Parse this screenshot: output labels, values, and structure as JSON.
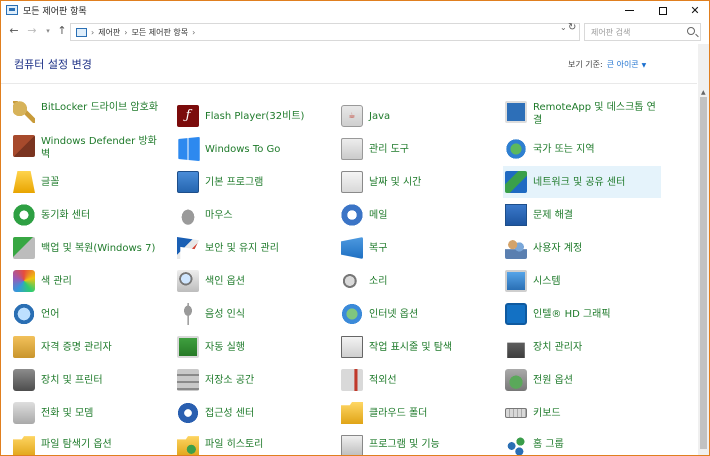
{
  "window": {
    "title": "모든 제어판 항목"
  },
  "address_bar": {
    "segments": [
      "제어판",
      "모든 제어판 항목"
    ],
    "search_placeholder": "제어판 검색"
  },
  "header": {
    "heading": "컴퓨터 설정 변경",
    "view_by_label": "보기 기준:",
    "view_by_value": "큰 아이콘"
  },
  "items": [
    {
      "label": "BitLocker 드라이브 암호화",
      "icon": "key-icon"
    },
    {
      "label": "Flash Player(32비트)",
      "icon": "flash-icon"
    },
    {
      "label": "Java",
      "icon": "java-icon"
    },
    {
      "label": "RemoteApp 및 데스크톱 연결",
      "icon": "remote-desktop-icon"
    },
    {
      "label": "Windows Defender 방화벽",
      "icon": "firewall-icon"
    },
    {
      "label": "Windows To Go",
      "icon": "windows-icon"
    },
    {
      "label": "관리 도구",
      "icon": "admin-tools-icon"
    },
    {
      "label": "국가 또는 지역",
      "icon": "globe-icon"
    },
    {
      "label": "글꼴",
      "icon": "font-folder-icon"
    },
    {
      "label": "기본 프로그램",
      "icon": "default-programs-icon"
    },
    {
      "label": "날짜 및 시간",
      "icon": "calendar-clock-icon"
    },
    {
      "label": "네트워크 및 공유 센터",
      "icon": "network-icon"
    },
    {
      "label": "동기화 센터",
      "icon": "sync-icon"
    },
    {
      "label": "마우스",
      "icon": "mouse-icon"
    },
    {
      "label": "메일",
      "icon": "mail-icon"
    },
    {
      "label": "문제 해결",
      "icon": "troubleshoot-icon"
    },
    {
      "label": "백업 및 복원(Windows 7)",
      "icon": "backup-icon"
    },
    {
      "label": "보안 및 유지 관리",
      "icon": "flag-icon"
    },
    {
      "label": "복구",
      "icon": "recovery-icon"
    },
    {
      "label": "사용자 계정",
      "icon": "user-accounts-icon"
    },
    {
      "label": "색 관리",
      "icon": "color-management-icon"
    },
    {
      "label": "색인 옵션",
      "icon": "indexing-icon"
    },
    {
      "label": "소리",
      "icon": "speaker-icon"
    },
    {
      "label": "시스템",
      "icon": "system-icon"
    },
    {
      "label": "언어",
      "icon": "language-icon"
    },
    {
      "label": "음성 인식",
      "icon": "microphone-icon"
    },
    {
      "label": "인터넷 옵션",
      "icon": "internet-options-icon"
    },
    {
      "label": "인텔® HD 그래픽",
      "icon": "intel-graphics-icon"
    },
    {
      "label": "자격 증명 관리자",
      "icon": "credential-icon"
    },
    {
      "label": "자동 실행",
      "icon": "autoplay-icon"
    },
    {
      "label": "작업 표시줄 및 탐색",
      "icon": "taskbar-icon"
    },
    {
      "label": "장치 관리자",
      "icon": "device-manager-icon"
    },
    {
      "label": "장치 및 프린터",
      "icon": "printer-icon"
    },
    {
      "label": "저장소 공간",
      "icon": "storage-icon"
    },
    {
      "label": "적외선",
      "icon": "infrared-icon"
    },
    {
      "label": "전원 옵션",
      "icon": "power-icon"
    },
    {
      "label": "전화 및 모뎀",
      "icon": "phone-icon"
    },
    {
      "label": "접근성 센터",
      "icon": "ease-of-access-icon"
    },
    {
      "label": "클라우드 폴더",
      "icon": "cloud-folder-icon"
    },
    {
      "label": "키보드",
      "icon": "keyboard-icon"
    },
    {
      "label": "파일 탐색기 옵션",
      "icon": "folder-options-icon"
    },
    {
      "label": "파일 히스토리",
      "icon": "file-history-icon"
    },
    {
      "label": "프로그램 및 기능",
      "icon": "programs-icon"
    },
    {
      "label": "홈 그룹",
      "icon": "homegroup-icon"
    }
  ]
}
